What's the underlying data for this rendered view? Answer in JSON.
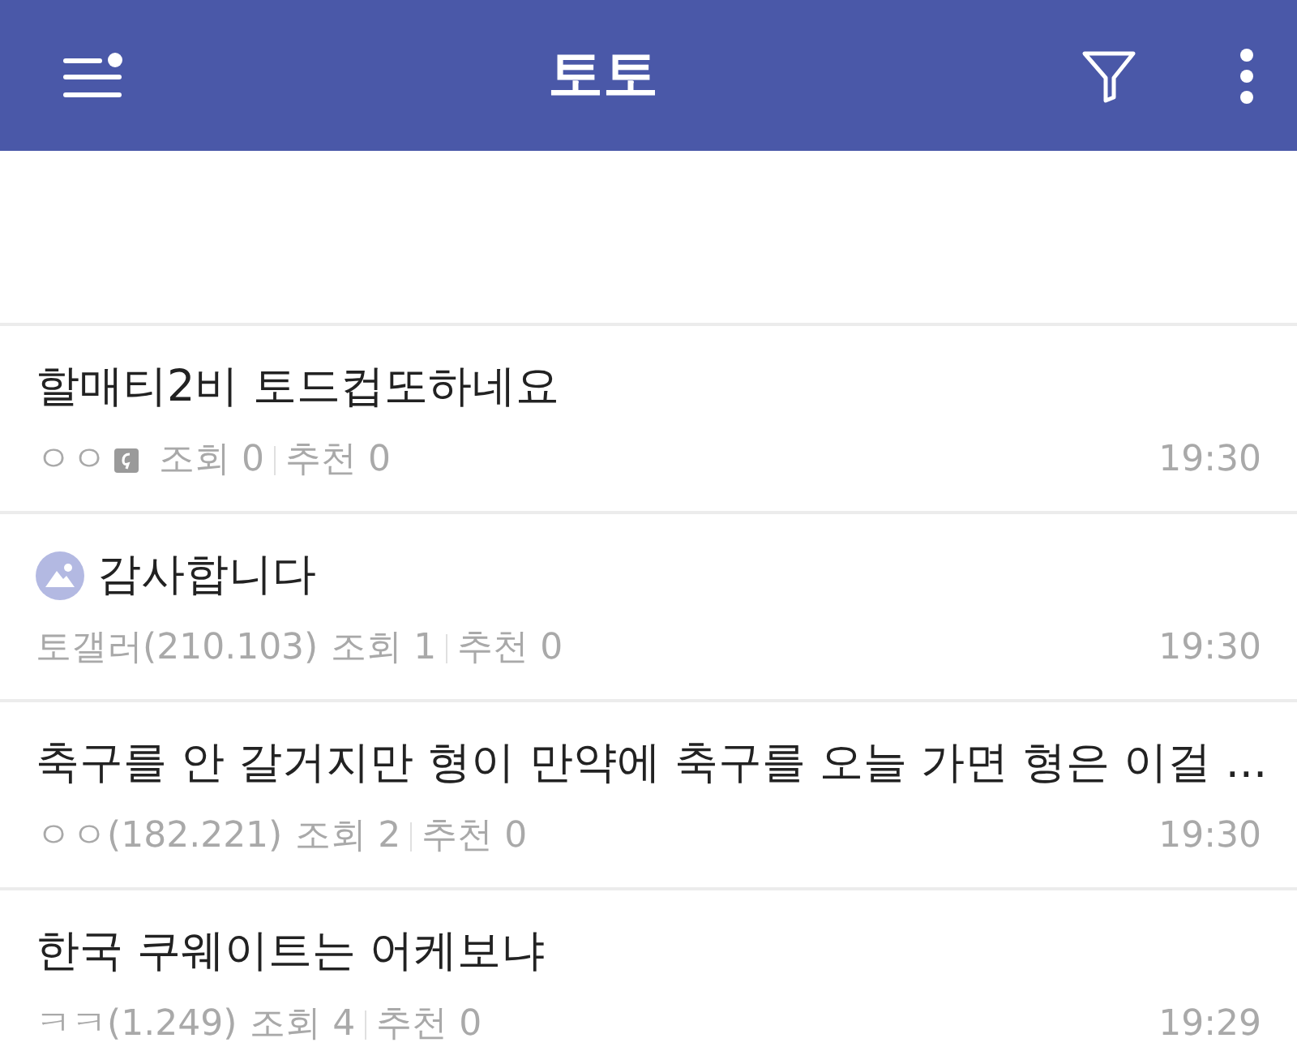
{
  "app_bar": {
    "title": "토토"
  },
  "posts": [
    {
      "title": "할매티2비 토드컵또하네요",
      "has_image": false,
      "author": "ㅇㅇ",
      "member_badge": true,
      "views": "조회 0",
      "recommends": "추천 0",
      "time": "19:30"
    },
    {
      "title": "감사합니다",
      "has_image": true,
      "author": "토갤러(210.103)",
      "member_badge": false,
      "views": "조회 1",
      "recommends": "추천 0",
      "time": "19:30"
    },
    {
      "title": "축구를 안 갈거지만 형이 만약에 축구를 오늘 가면 형은 이걸 ...",
      "has_image": false,
      "author": "ㅇㅇ(182.221)",
      "member_badge": false,
      "views": "조회 2",
      "recommends": "추천 0",
      "time": "19:30"
    },
    {
      "title": "한국 쿠웨이트는 어케보냐",
      "has_image": false,
      "author": "ㅋㅋ(1.249)",
      "member_badge": false,
      "views": "조회 4",
      "recommends": "추천 0",
      "time": "19:29"
    }
  ]
}
